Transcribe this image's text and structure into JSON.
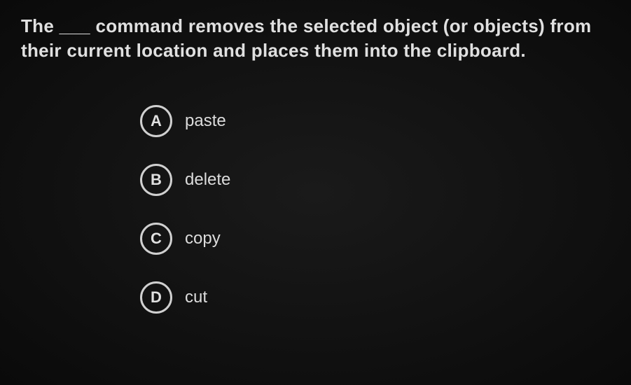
{
  "question": {
    "text": "The ___ command removes the selected object (or objects) from their current location and places them into the clipboard."
  },
  "options": [
    {
      "letter": "A",
      "label": "paste"
    },
    {
      "letter": "B",
      "label": "delete"
    },
    {
      "letter": "C",
      "label": "copy"
    },
    {
      "letter": "D",
      "label": "cut"
    }
  ]
}
